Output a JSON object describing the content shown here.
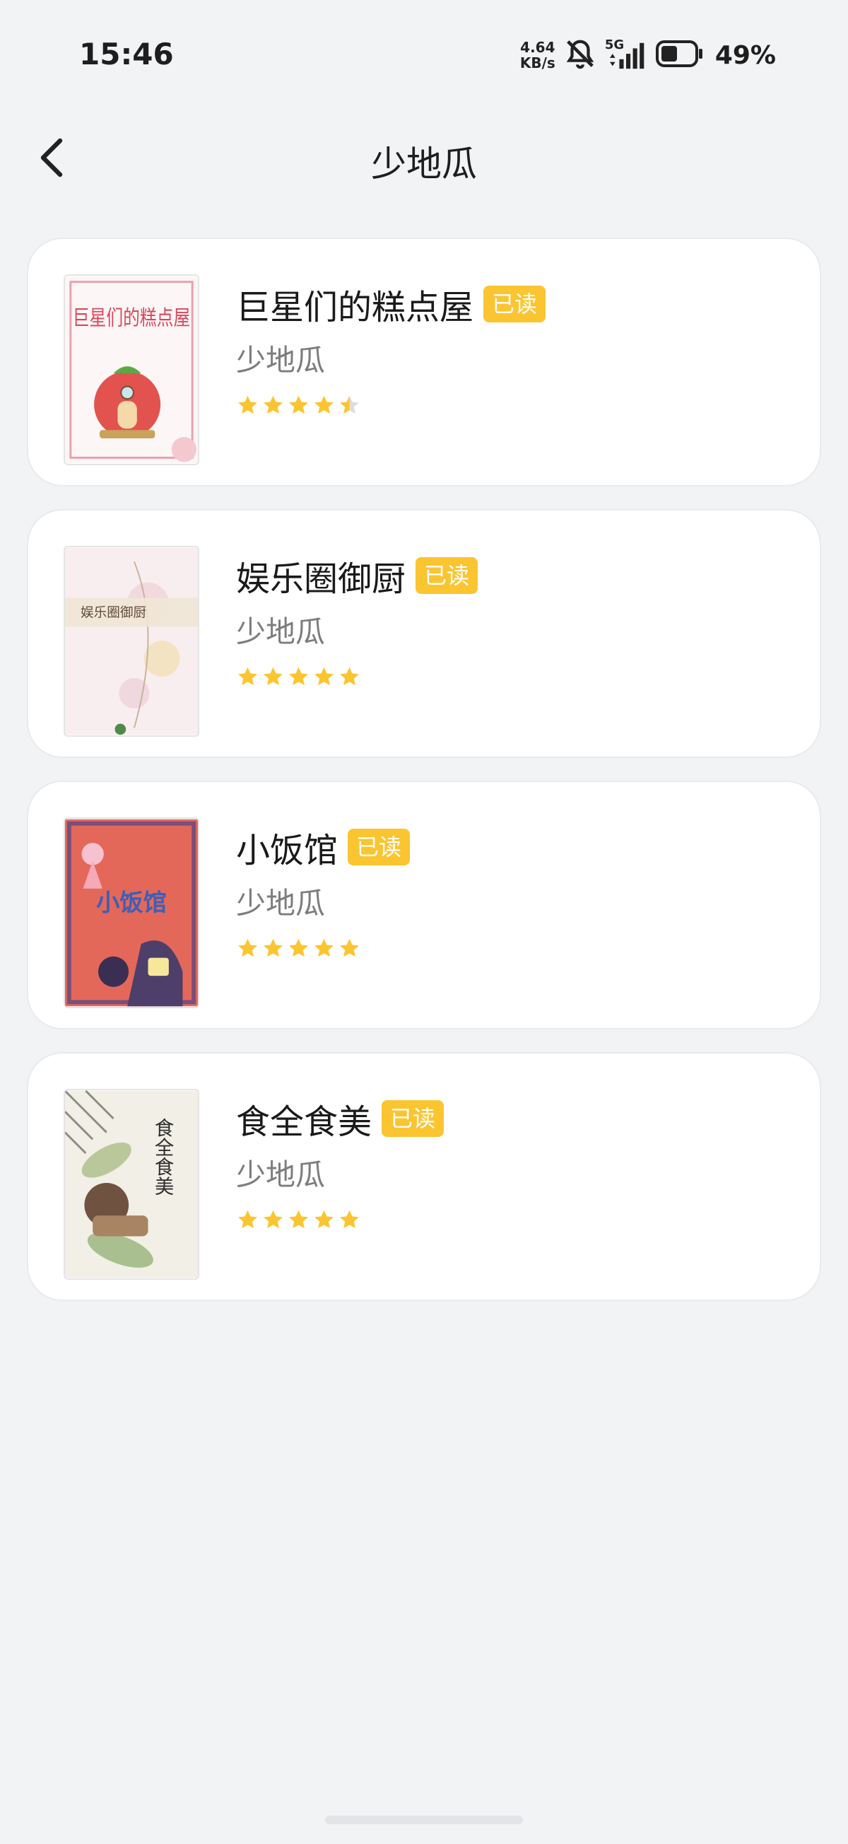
{
  "status_bar": {
    "time": "15:46",
    "net_speed_value": "4.64",
    "net_speed_unit": "KB/s",
    "network": "5G",
    "battery_percent": "49%",
    "icons": [
      "bell-muted-icon",
      "signal-icon",
      "battery-icon"
    ]
  },
  "header": {
    "title": "少地瓜",
    "back_icon": "back-chevron-icon"
  },
  "books": [
    {
      "title": "巨星们的糕点屋",
      "badge": "已读",
      "author": "少地瓜",
      "rating": 4.5,
      "cover_text": "巨星们的糕点屋"
    },
    {
      "title": "娱乐圈御厨",
      "badge": "已读",
      "author": "少地瓜",
      "rating": 5,
      "cover_text": "娱乐圈御厨"
    },
    {
      "title": "小饭馆",
      "badge": "已读",
      "author": "少地瓜",
      "rating": 5,
      "cover_text": "小饭馆"
    },
    {
      "title": "食全食美",
      "badge": "已读",
      "author": "少地瓜",
      "rating": 5,
      "cover_text": "食全食美"
    }
  ],
  "colors": {
    "badge": "#fbc531",
    "star": "#fbc531",
    "star_empty": "#dddddd",
    "background": "#f2f3f5"
  }
}
